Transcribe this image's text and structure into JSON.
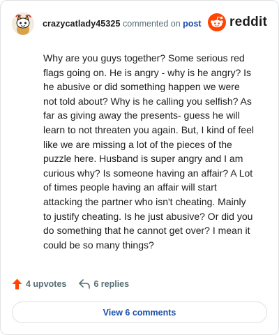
{
  "comment": {
    "username": "crazycatlady45325",
    "action_text": "commented on",
    "post_link": "post",
    "body": "Why are you guys together? Some serious red flags going on. He is angry - why is he angry? Is he abusive or did something happen we were not told about? Why is he calling you selfish? As far as giving away the presents- guess he will learn to not threaten you again. But, I kind of feel like we are missing a lot of the pieces of the puzzle here. Husband is super angry and I am curious why? Is someone having an affair? A Lot of times people having an affair will start attacking the partner who isn't cheating. Mainly to justify cheating. Is he just abusive? Or did you do something that he cannot get over? I mean it could be so many things?"
  },
  "brand": {
    "wordmark": "reddit",
    "color": "#ff4500"
  },
  "actions": {
    "upvotes": "4 upvotes",
    "replies": "6 replies"
  },
  "footer": {
    "view_comments": "View 6 comments"
  },
  "icons": {
    "avatar": "snoo-avatar-icon",
    "logo": "reddit-logo-icon",
    "upvote": "upvote-arrow-icon",
    "reply": "reply-arrow-icon"
  },
  "colors": {
    "upvote": "#ff4500",
    "link": "#1a4fa8",
    "muted": "#576f76"
  }
}
